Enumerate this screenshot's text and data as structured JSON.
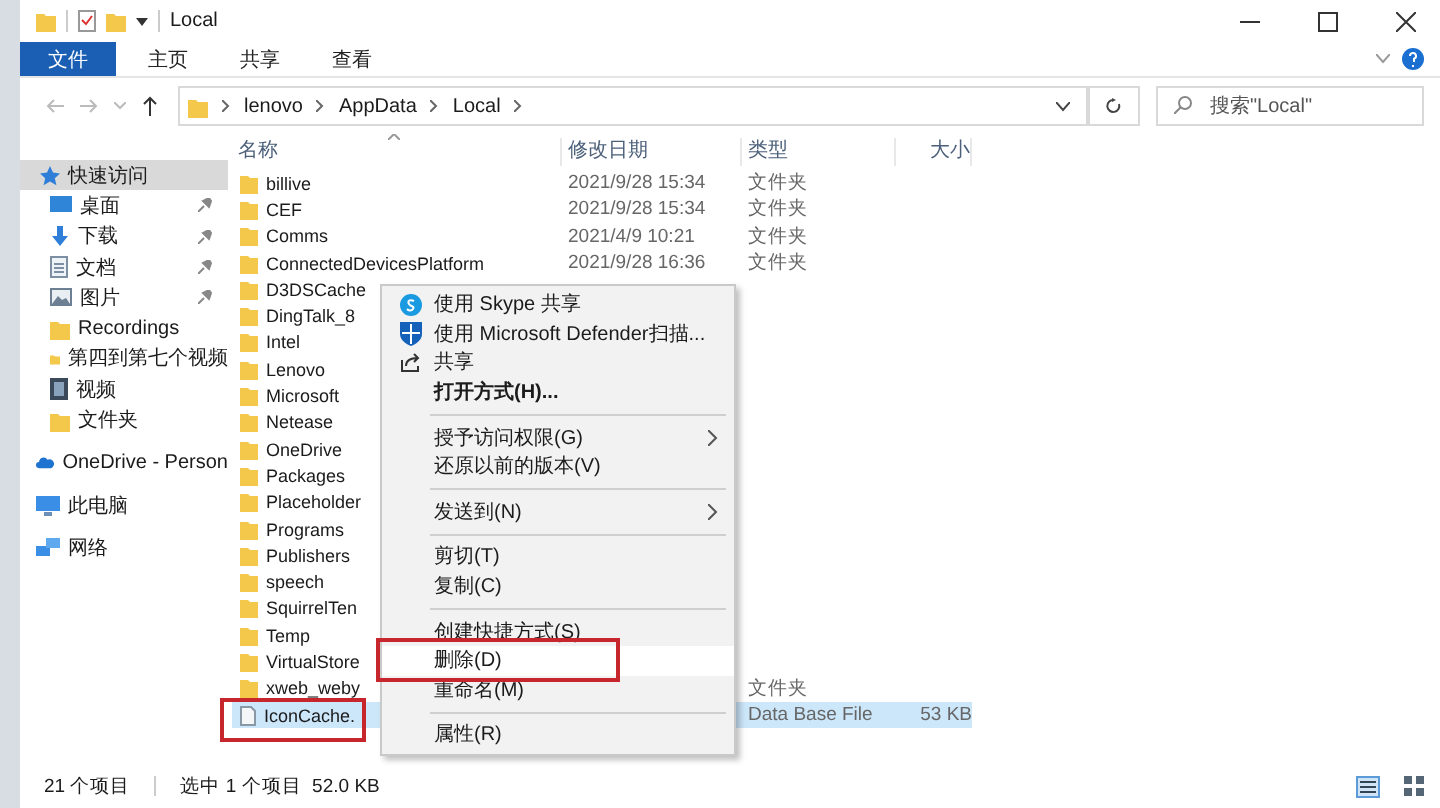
{
  "window": {
    "title": "Local"
  },
  "ribbon_tabs": [
    {
      "label": "文件",
      "selected": true
    },
    {
      "label": "主页",
      "selected": false
    },
    {
      "label": "共享",
      "selected": false
    },
    {
      "label": "查看",
      "selected": false
    }
  ],
  "address": {
    "path": [
      "lenovo",
      "AppData",
      "Local"
    ]
  },
  "search": {
    "placeholder": "搜索\"Local\""
  },
  "sidebar": [
    {
      "label": "快速访问",
      "kind": "star",
      "selected": true,
      "children": [
        {
          "label": "桌面",
          "kind": "desktop",
          "pinned": true
        },
        {
          "label": "下载",
          "kind": "download",
          "pinned": true
        },
        {
          "label": "文档",
          "kind": "document",
          "pinned": true
        },
        {
          "label": "图片",
          "kind": "image",
          "pinned": true
        },
        {
          "label": "Recordings",
          "kind": "folder"
        },
        {
          "label": "第四到第七个视频",
          "kind": "folder"
        },
        {
          "label": "视频",
          "kind": "video"
        },
        {
          "label": "文件夹",
          "kind": "folder"
        }
      ]
    },
    {
      "label": "OneDrive - Person",
      "kind": "cloud",
      "selected": false
    },
    {
      "label": "此电脑",
      "kind": "pc",
      "selected": false
    },
    {
      "label": "网络",
      "kind": "network",
      "selected": false
    }
  ],
  "columns": [
    "名称",
    "修改日期",
    "类型",
    "大小"
  ],
  "rows": [
    {
      "name": "billive",
      "date": "2021/9/28 15:34",
      "type": "文件夹",
      "kind": "folder",
      "selected": false
    },
    {
      "name": "CEF",
      "date": "2021/9/28 15:34",
      "type": "文件夹",
      "kind": "folder",
      "selected": false
    },
    {
      "name": "Comms",
      "date": "2021/4/9 10:21",
      "type": "文件夹",
      "kind": "folder",
      "selected": false
    },
    {
      "name": "ConnectedDevicesPlatform",
      "date": "2021/9/28 16:36",
      "type": "文件夹",
      "kind": "folder",
      "selected": false
    },
    {
      "name": "D3DSCache",
      "kind": "folder",
      "selected": false
    },
    {
      "name": "DingTalk_8",
      "kind": "folder",
      "selected": false
    },
    {
      "name": "Intel",
      "kind": "folder",
      "selected": false
    },
    {
      "name": "Lenovo",
      "kind": "folder",
      "selected": false
    },
    {
      "name": "Microsoft",
      "kind": "folder",
      "selected": false
    },
    {
      "name": "Netease",
      "kind": "folder",
      "selected": false
    },
    {
      "name": "OneDrive",
      "kind": "folder",
      "selected": false
    },
    {
      "name": "Packages",
      "kind": "folder",
      "selected": false
    },
    {
      "name": "Placeholder",
      "kind": "folder",
      "selected": false
    },
    {
      "name": "Programs",
      "kind": "folder",
      "selected": false
    },
    {
      "name": "Publishers",
      "kind": "folder",
      "selected": false
    },
    {
      "name": "speech",
      "kind": "folder",
      "selected": false
    },
    {
      "name": "SquirrelTen",
      "kind": "folder",
      "selected": false
    },
    {
      "name": "Temp",
      "kind": "folder",
      "selected": false
    },
    {
      "name": "VirtualStore",
      "kind": "folder",
      "selected": false
    },
    {
      "name": "xweb_weby",
      "type": "文件夹",
      "kind": "folder",
      "selected": false
    },
    {
      "name": "IconCache.",
      "type": "Data Base File",
      "size": "53 KB",
      "kind": "file",
      "selected": true,
      "marked": true
    }
  ],
  "context_menu": [
    {
      "kind": "skype",
      "label": "使用 Skype 共享",
      "selected": false
    },
    {
      "kind": "shield",
      "label": "使用 Microsoft Defender扫描...",
      "selected": false
    },
    {
      "kind": "share",
      "label": "共享",
      "selected": false
    },
    {
      "kind": "item",
      "label": "打开方式(H)...",
      "default": true,
      "selected": false
    },
    {
      "kind": "separator"
    },
    {
      "kind": "item",
      "label": "授予访问权限(G)",
      "submenu": true,
      "selected": false
    },
    {
      "kind": "item",
      "label": "还原以前的版本(V)",
      "selected": false
    },
    {
      "kind": "separator"
    },
    {
      "kind": "item",
      "label": "发送到(N)",
      "submenu": true,
      "selected": false
    },
    {
      "kind": "separator"
    },
    {
      "kind": "item",
      "label": "剪切(T)",
      "selected": false
    },
    {
      "kind": "item",
      "label": "复制(C)",
      "selected": false
    },
    {
      "kind": "separator"
    },
    {
      "kind": "item",
      "label": "创建快捷方式(S)",
      "selected": false
    },
    {
      "kind": "item",
      "label": "删除(D)",
      "selected": true,
      "marked": true
    },
    {
      "kind": "item",
      "label": "重命名(M)",
      "selected": false
    },
    {
      "kind": "separator"
    },
    {
      "kind": "item",
      "label": "属性(R)",
      "selected": false
    }
  ],
  "status_bar": {
    "count": "21 个项目",
    "selection": "选中 1 个项目  52.0 KB"
  }
}
